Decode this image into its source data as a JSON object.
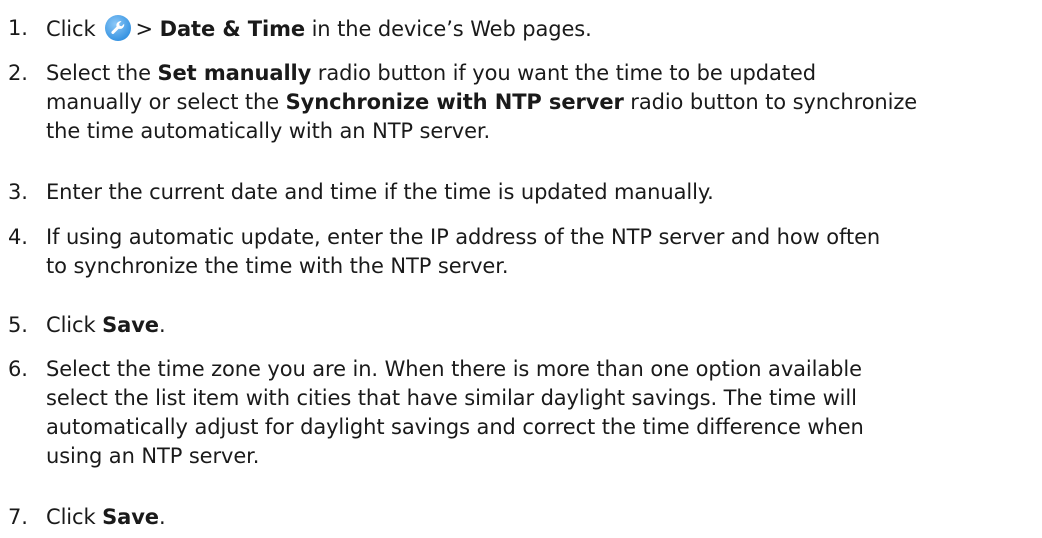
{
  "steps": [
    {
      "number": "1.",
      "lines": [
        [
          {
            "t": "Click",
            "b": false
          },
          {
            "icon": "settings-wrench-icon"
          },
          {
            "t": "> ",
            "b": false
          },
          {
            "t": "Date & Time",
            "b": true
          },
          {
            "t": " in the device’s Web pages.",
            "b": false
          }
        ]
      ]
    },
    {
      "number": "2.",
      "lines": [
        [
          {
            "t": "Select the ",
            "b": false
          },
          {
            "t": "Set manually",
            "b": true
          },
          {
            "t": " radio button if you want the time to be updated",
            "b": false
          }
        ],
        [
          {
            "t": "manually or select the ",
            "b": false
          },
          {
            "t": "Synchronize with NTP server",
            "b": true
          },
          {
            "t": " radio button to synchronize",
            "b": false
          }
        ],
        [
          {
            "t": "the time automatically with an NTP server.",
            "b": false
          }
        ]
      ]
    },
    {
      "number": "3.",
      "lines": [
        [
          {
            "t": "Enter the current date and time if the time is updated manually.",
            "b": false
          }
        ]
      ]
    },
    {
      "number": "4.",
      "lines": [
        [
          {
            "t": "If using automatic update, enter the IP address of the NTP server and how often",
            "b": false
          }
        ],
        [
          {
            "t": "to synchronize the time with the NTP server.",
            "b": false
          }
        ]
      ]
    },
    {
      "number": "5.",
      "lines": [
        [
          {
            "t": "Click ",
            "b": false
          },
          {
            "t": "Save",
            "b": true
          },
          {
            "t": ".",
            "b": false
          }
        ]
      ]
    },
    {
      "number": "6.",
      "lines": [
        [
          {
            "t": "Select the time zone you are in. When there is more than one option available",
            "b": false
          }
        ],
        [
          {
            "t": "select the list item with cities that have similar daylight savings. The time will",
            "b": false
          }
        ],
        [
          {
            "t": "automatically adjust for daylight savings and correct the time difference when",
            "b": false
          }
        ],
        [
          {
            "t": "using an NTP server.",
            "b": false
          }
        ]
      ]
    },
    {
      "number": "7.",
      "lines": [
        [
          {
            "t": "Click ",
            "b": false
          },
          {
            "t": "Save",
            "b": true
          },
          {
            "t": ".",
            "b": false
          }
        ]
      ]
    }
  ],
  "colors": {
    "text": "#1a1a1a",
    "icon_blue": "#2f8fe0",
    "icon_light": "#8cc8f7",
    "background": "#ffffff"
  }
}
